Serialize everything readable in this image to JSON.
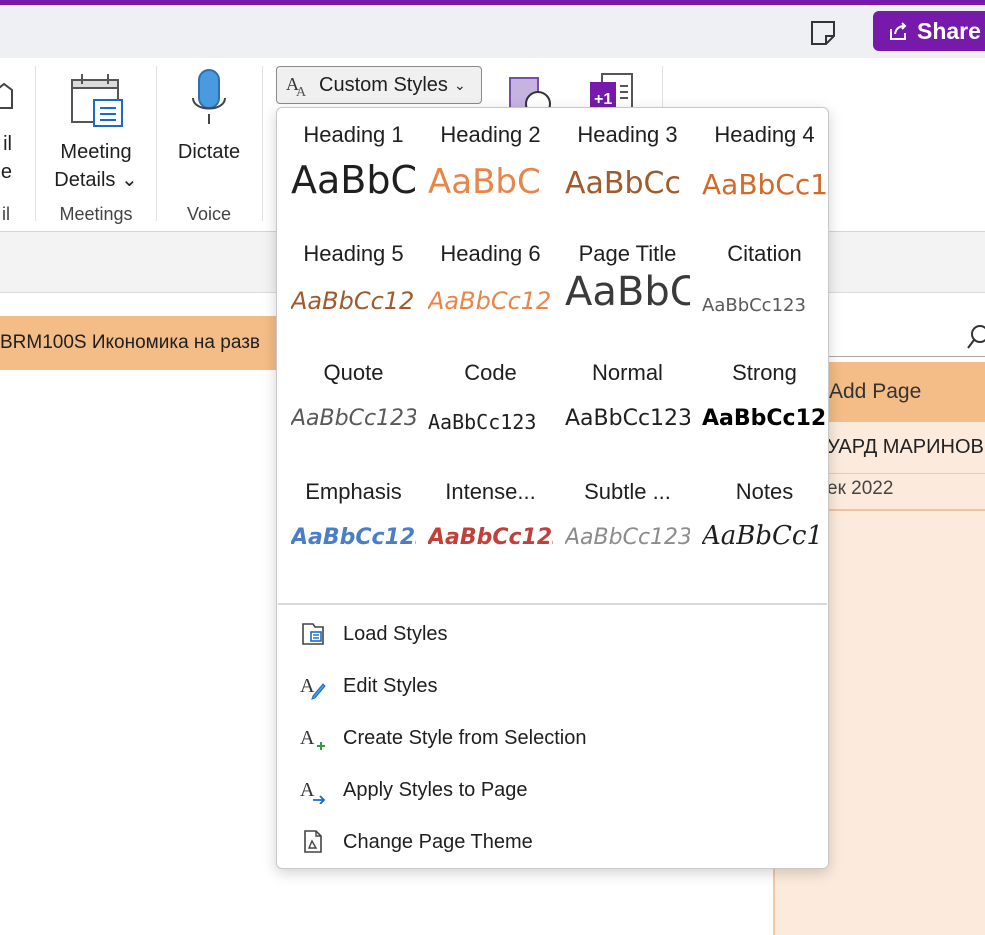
{
  "titlebar": {
    "share_label": "Share",
    "fullpage_icon": "full-page-view-icon"
  },
  "ribbon": {
    "partial_left": {
      "line1": "il",
      "line2": "e",
      "group": "il"
    },
    "meeting_details": {
      "line1": "Meeting",
      "line2": "Details ⌄",
      "group": "Meetings"
    },
    "dictate": {
      "label": "Dictate",
      "group": "Voice"
    },
    "custom_styles": {
      "label": "Custom Styles",
      "chevron": "⌄"
    }
  },
  "section": {
    "tab_label": "BRM100S Икономика на разв"
  },
  "pages": {
    "add_page": "Add Page",
    "page_name": "УАРД МАРИНОВ",
    "page_date": "ек 2022"
  },
  "styles": [
    {
      "name": "Heading 1",
      "sample": "AaBbC",
      "color": "#1f1f1f"
    },
    {
      "name": "Heading 2",
      "sample": "AaBbC",
      "color": "#e8864a"
    },
    {
      "name": "Heading 3",
      "sample": "AaBbCc",
      "color": "#a05a2c"
    },
    {
      "name": "Heading 4",
      "sample": "AaBbCc1",
      "color": "#d26a2a"
    },
    {
      "name": "Heading 5",
      "sample": "AaBbCc12",
      "color": "#a05a2c"
    },
    {
      "name": "Heading 6",
      "sample": "AaBbCc12",
      "color": "#e8864a"
    },
    {
      "name": "Page Title",
      "sample": "AaBbC",
      "color": "#3a3a3a"
    },
    {
      "name": "Citation",
      "sample": "AaBbCc123",
      "color": "#595959"
    },
    {
      "name": "Quote",
      "sample": "AaBbCc123",
      "color": "#595959"
    },
    {
      "name": "Code",
      "sample": "AaBbCc123",
      "color": "#1f1f1f"
    },
    {
      "name": "Normal",
      "sample": "AaBbCc123",
      "color": "#1f1f1f"
    },
    {
      "name": "Strong",
      "sample": "AaBbCc123",
      "color": "#000000"
    },
    {
      "name": "Emphasis",
      "sample": "AaBbCc123",
      "color": "#4a7fc6"
    },
    {
      "name": "Intense...",
      "sample": "AaBbCc123",
      "color": "#c0413b"
    },
    {
      "name": "Subtle ...",
      "sample": "AaBbCc123",
      "color": "#8c8c8c"
    },
    {
      "name": "Notes",
      "sample": "AaBbCc1",
      "color": "#1f1f1f"
    }
  ],
  "menu": [
    {
      "label": "Load Styles",
      "icon": "load-styles-icon"
    },
    {
      "label": "Edit Styles",
      "icon": "edit-styles-icon"
    },
    {
      "label": "Create Style from Selection",
      "icon": "create-style-icon"
    },
    {
      "label": "Apply Styles to Page",
      "icon": "apply-styles-icon"
    },
    {
      "label": "Change Page Theme",
      "icon": "change-page-theme-icon"
    }
  ]
}
